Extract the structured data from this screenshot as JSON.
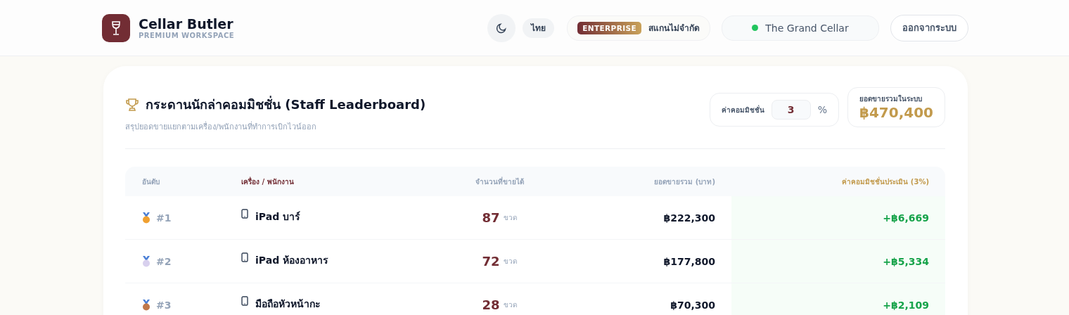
{
  "brand": {
    "name": "Cellar Butler",
    "subtitle": "PREMIUM WORKSPACE"
  },
  "header": {
    "language": "ไทย",
    "plan_badge": "ENTERPRISE",
    "plan_note": "สแกนไม่จำกัด",
    "venue": {
      "name": "The Grand Cellar",
      "color": "#22c55e"
    },
    "logout": "ออกจากระบบ"
  },
  "leaderboard": {
    "title": "กระดานนักล่าคอมมิชชั่น (Staff Leaderboard)",
    "subtitle": "สรุปยอดขายแยกตามเครื่อง/พนักงานที่ทำการเบิกไวน์ออก",
    "commission": {
      "label": "ค่าคอมมิชชั่น",
      "value": "3",
      "unit": "%"
    },
    "total": {
      "label": "ยอดขายรวมในระบบ",
      "value": "฿470,400"
    },
    "table": {
      "columns": [
        "อันดับ",
        "เครื่อง / พนักงาน",
        "จำนวนที่ขายได้",
        "ยอดขายรวม (บาท)",
        "ค่าคอมมิชชั่นประเมิน (3%)"
      ],
      "rows": [
        {
          "rank": "#1",
          "color": "#f0a030",
          "device": "iPad บาร์",
          "qty": "87",
          "unit": "ขวด",
          "sales": "฿222,300",
          "commission": "+฿6,669"
        },
        {
          "rank": "#2",
          "color": "#d8d0ee",
          "device": "iPad ห้องอาหาร",
          "qty": "72",
          "unit": "ขวด",
          "sales": "฿177,800",
          "commission": "+฿5,334"
        },
        {
          "rank": "#3",
          "color": "#c0784a",
          "device": "มือถือหัวหน้ากะ",
          "qty": "28",
          "unit": "ขวด",
          "sales": "฿70,300",
          "commission": "+฿2,109"
        }
      ]
    }
  }
}
